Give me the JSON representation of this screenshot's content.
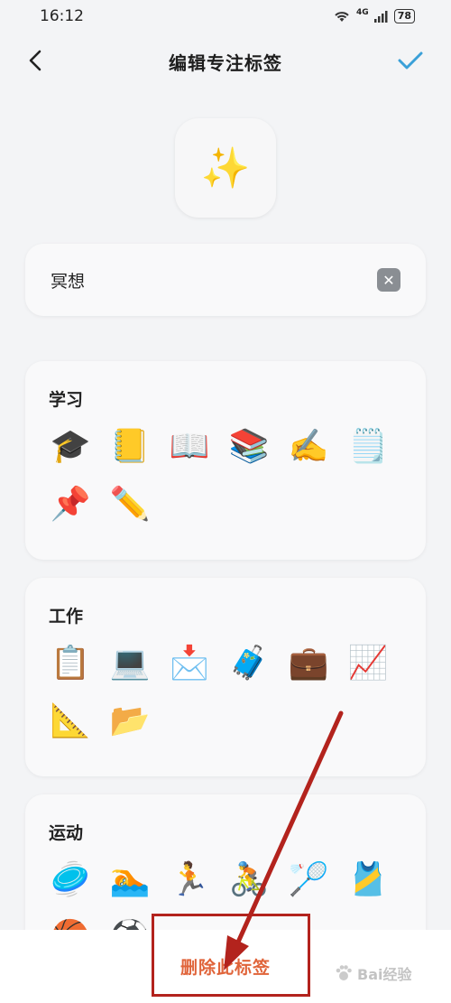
{
  "status_bar": {
    "time": "16:12",
    "network": "4G",
    "battery": "78"
  },
  "nav": {
    "title": "编辑专注标签",
    "back_icon": "chevron-left-icon",
    "confirm_icon": "check-icon",
    "accent_color": "#3aa0d8"
  },
  "preview": {
    "emoji": "✨"
  },
  "name_field": {
    "value": "冥想",
    "clear_icon": "clear-x-icon"
  },
  "groups": [
    {
      "title": "学习",
      "emojis": [
        "🎓",
        "📒",
        "📖",
        "📚",
        "✍️",
        "🗒️",
        "📌",
        "✏️"
      ]
    },
    {
      "title": "工作",
      "emojis": [
        "📋",
        "💻",
        "📩",
        "🧳",
        "💼",
        "📈",
        "📐",
        "📂"
      ]
    },
    {
      "title": "运动",
      "emojis": [
        "🥏",
        "🏊",
        "🏃",
        "🚴",
        "🏸",
        "🎽",
        "🏀",
        "⚽"
      ]
    }
  ],
  "bottom": {
    "delete_label": "删除此标签",
    "delete_color": "#e0643a"
  },
  "annotation": {
    "color": "#b3231d"
  },
  "watermark": {
    "text": "Bai经验"
  }
}
